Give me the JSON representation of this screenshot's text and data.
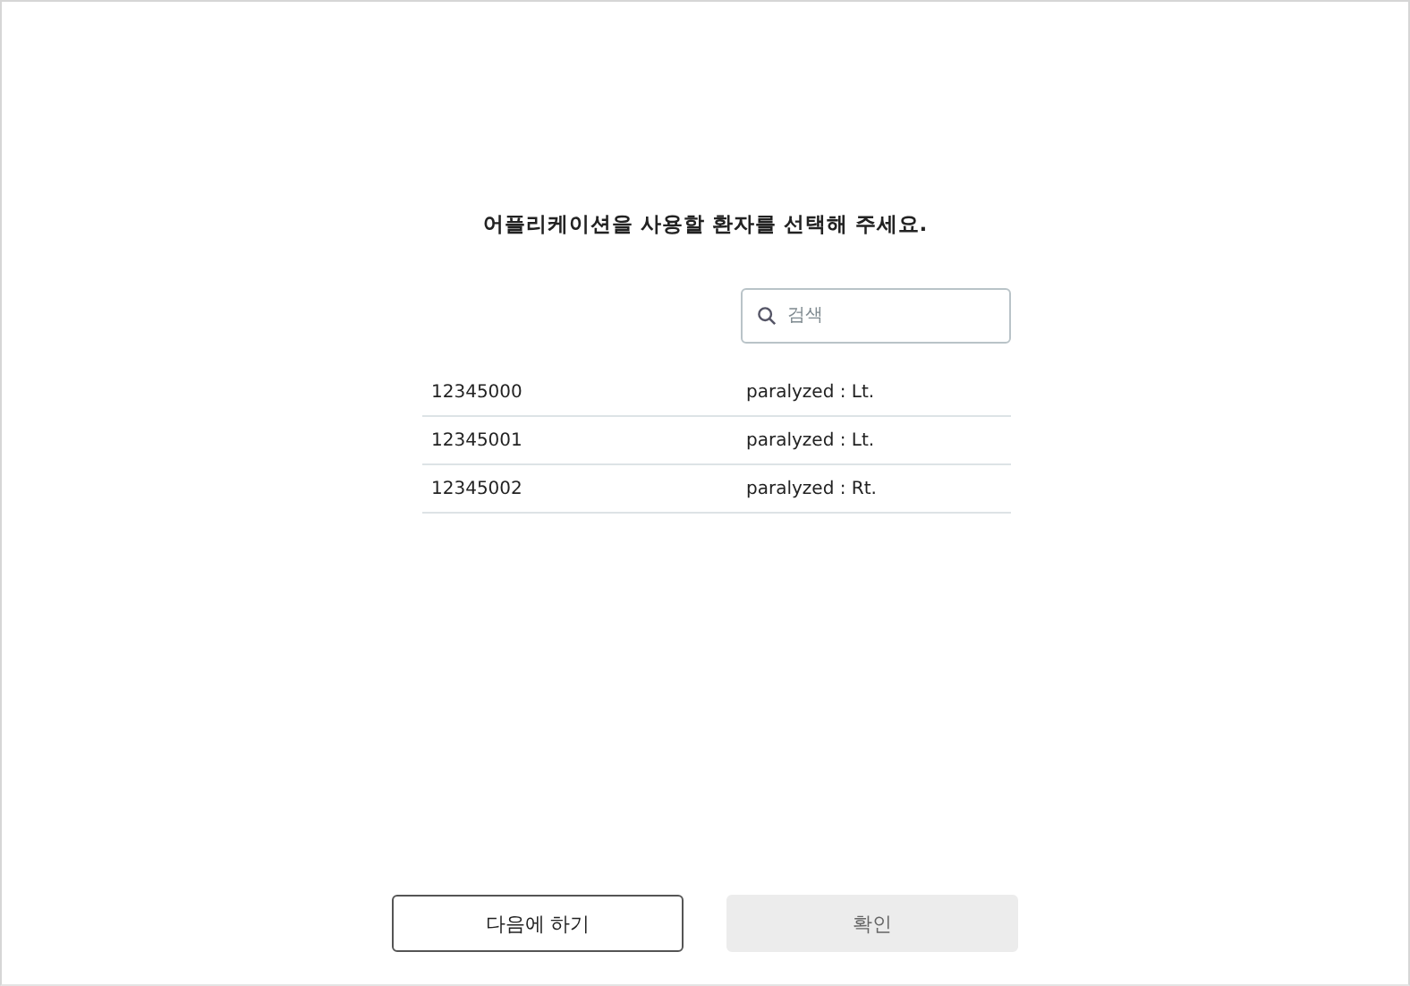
{
  "prompt": "어플리케이션을 사용할 환자를 선택해 주세요.",
  "search": {
    "placeholder": "검색"
  },
  "patients": [
    {
      "id": "12345000",
      "condition": "paralyzed : Lt."
    },
    {
      "id": "12345001",
      "condition": "paralyzed : Lt."
    },
    {
      "id": "12345002",
      "condition": "paralyzed : Rt."
    }
  ],
  "buttons": [
    {
      "label": "다음에 하기",
      "disabled": false
    },
    {
      "label": "확인",
      "disabled": true
    }
  ]
}
